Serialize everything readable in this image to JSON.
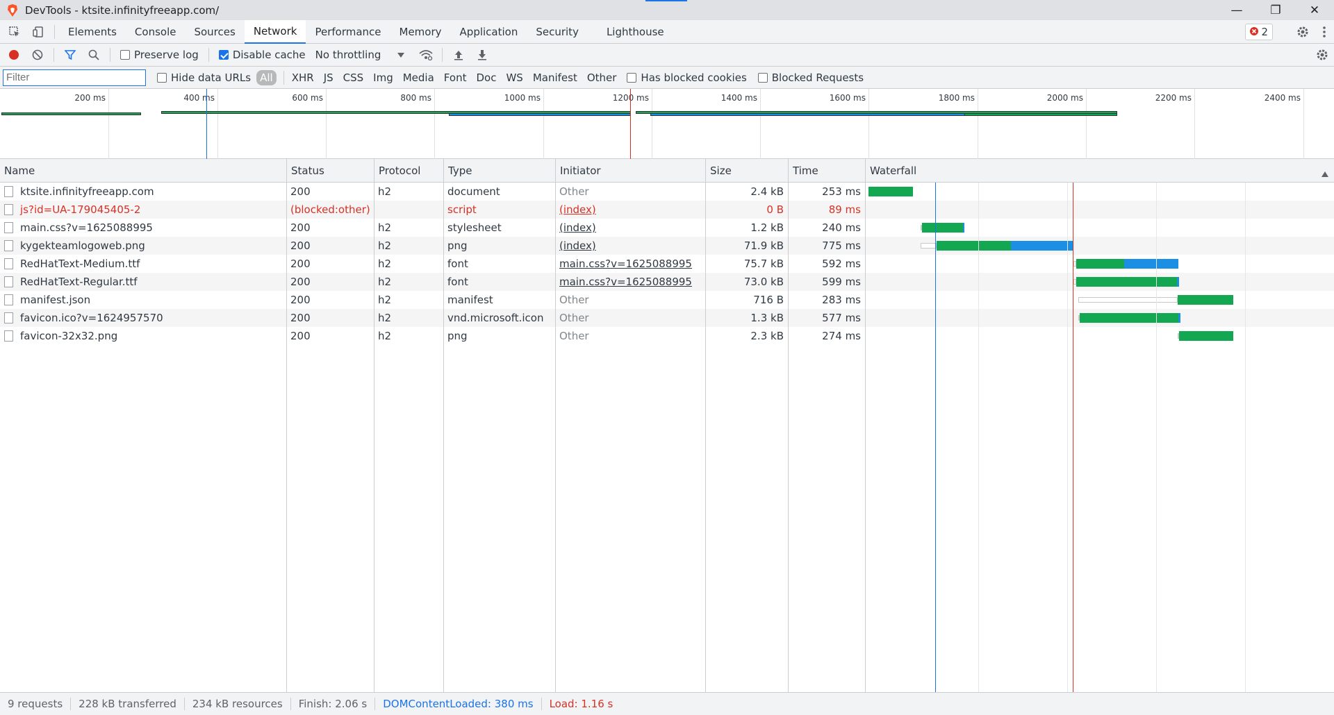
{
  "window": {
    "title": "DevTools - ktsite.infinityfreeapp.com/",
    "minimize": "—",
    "maximize": "❐",
    "close": "✕"
  },
  "tabs": [
    "Elements",
    "Console",
    "Sources",
    "Network",
    "Performance",
    "Memory",
    "Application",
    "Security",
    "Lighthouse"
  ],
  "active_tab": "Network",
  "error_count": "2",
  "toolbar": {
    "preserve_log": "Preserve log",
    "disable_cache": "Disable cache",
    "throttling": "No throttling"
  },
  "filterbar": {
    "filter_placeholder": "Filter",
    "hide_data_urls": "Hide data URLs",
    "types": [
      "All",
      "XHR",
      "JS",
      "CSS",
      "Img",
      "Media",
      "Font",
      "Doc",
      "WS",
      "Manifest",
      "Other"
    ],
    "has_blocked_cookies": "Has blocked cookies",
    "blocked_requests": "Blocked Requests"
  },
  "overview": {
    "ticks": [
      "200 ms",
      "400 ms",
      "600 ms",
      "800 ms",
      "1000 ms",
      "1200 ms",
      "1400 ms",
      "1600 ms",
      "1800 ms",
      "2000 ms",
      "2200 ms",
      "2400 ms"
    ]
  },
  "columns": [
    "Name",
    "Status",
    "Protocol",
    "Type",
    "Initiator",
    "Size",
    "Time",
    "Waterfall"
  ],
  "rows": [
    {
      "name": "ktsite.infinityfreeapp.com",
      "status": "200",
      "protocol": "h2",
      "type": "document",
      "initiator": "Other",
      "size": "2.4 kB",
      "time": "253 ms",
      "wait_start": 0,
      "wait_end": 0,
      "green_end": 0.253,
      "blue_end": 0.253
    },
    {
      "name": "js?id=UA-179045405-2",
      "status": "(blocked:other)",
      "protocol": "",
      "type": "script",
      "initiator": "(index)",
      "size": "0 B",
      "time": "89 ms",
      "blocked": true
    },
    {
      "name": "main.css?v=1625088995",
      "status": "200",
      "protocol": "h2",
      "type": "stylesheet",
      "initiator": "(index)",
      "size": "1.2 kB",
      "time": "240 ms",
      "wait_start": 0.295,
      "wait_end": 0.305,
      "green_end": 0.535,
      "blue_end": 0.545
    },
    {
      "name": "kygekteamlogoweb.png",
      "status": "200",
      "protocol": "h2",
      "type": "png",
      "initiator": "(index)",
      "size": "71.9 kB",
      "time": "775 ms",
      "wait_start": 0.295,
      "wait_end": 0.385,
      "green_end": 0.81,
      "blue_end": 1.16
    },
    {
      "name": "RedHatText-Medium.ttf",
      "status": "200",
      "protocol": "h2",
      "type": "font",
      "initiator": "main.css?v=1625088995",
      "size": "75.7 kB",
      "time": "592 ms",
      "wait_start": 1.165,
      "wait_end": 1.18,
      "green_end": 1.45,
      "blue_end": 1.76
    },
    {
      "name": "RedHatText-Regular.ttf",
      "status": "200",
      "protocol": "h2",
      "type": "font",
      "initiator": "main.css?v=1625088995",
      "size": "73.0 kB",
      "time": "599 ms",
      "wait_start": 1.165,
      "wait_end": 1.18,
      "green_end": 1.75,
      "blue_end": 1.765
    },
    {
      "name": "manifest.json",
      "status": "200",
      "protocol": "h2",
      "type": "manifest",
      "initiator": "Other",
      "size": "716 B",
      "time": "283 ms",
      "wait_start": 1.19,
      "wait_end": 1.755,
      "green_end": 2.07,
      "blue_end": 2.07
    },
    {
      "name": "favicon.ico?v=1624957570",
      "status": "200",
      "protocol": "h2",
      "type": "vnd.microsoft.icon",
      "initiator": "Other",
      "size": "1.3 kB",
      "time": "577 ms",
      "wait_start": 1.19,
      "wait_end": 1.2,
      "green_end": 1.76,
      "blue_end": 1.77
    },
    {
      "name": "favicon-32x32.png",
      "status": "200",
      "protocol": "h2",
      "type": "png",
      "initiator": "Other",
      "size": "2.3 kB",
      "time": "274 ms",
      "wait_start": 1.755,
      "wait_end": 1.765,
      "green_end": 2.07,
      "blue_end": 2.07
    }
  ],
  "waterfall_markers": {
    "dom_content_loaded": 0.38,
    "load": 1.16
  },
  "status": {
    "requests": "9 requests",
    "transferred": "228 kB transferred",
    "resources": "234 kB resources",
    "finish": "Finish: 2.06 s",
    "dcl": "DOMContentLoaded: 380 ms",
    "load": "Load: 1.16 s"
  },
  "colors": {
    "receive": "#12a750",
    "download": "#1a8fe3",
    "dcl": "#1a73e8",
    "load": "#d93025"
  }
}
